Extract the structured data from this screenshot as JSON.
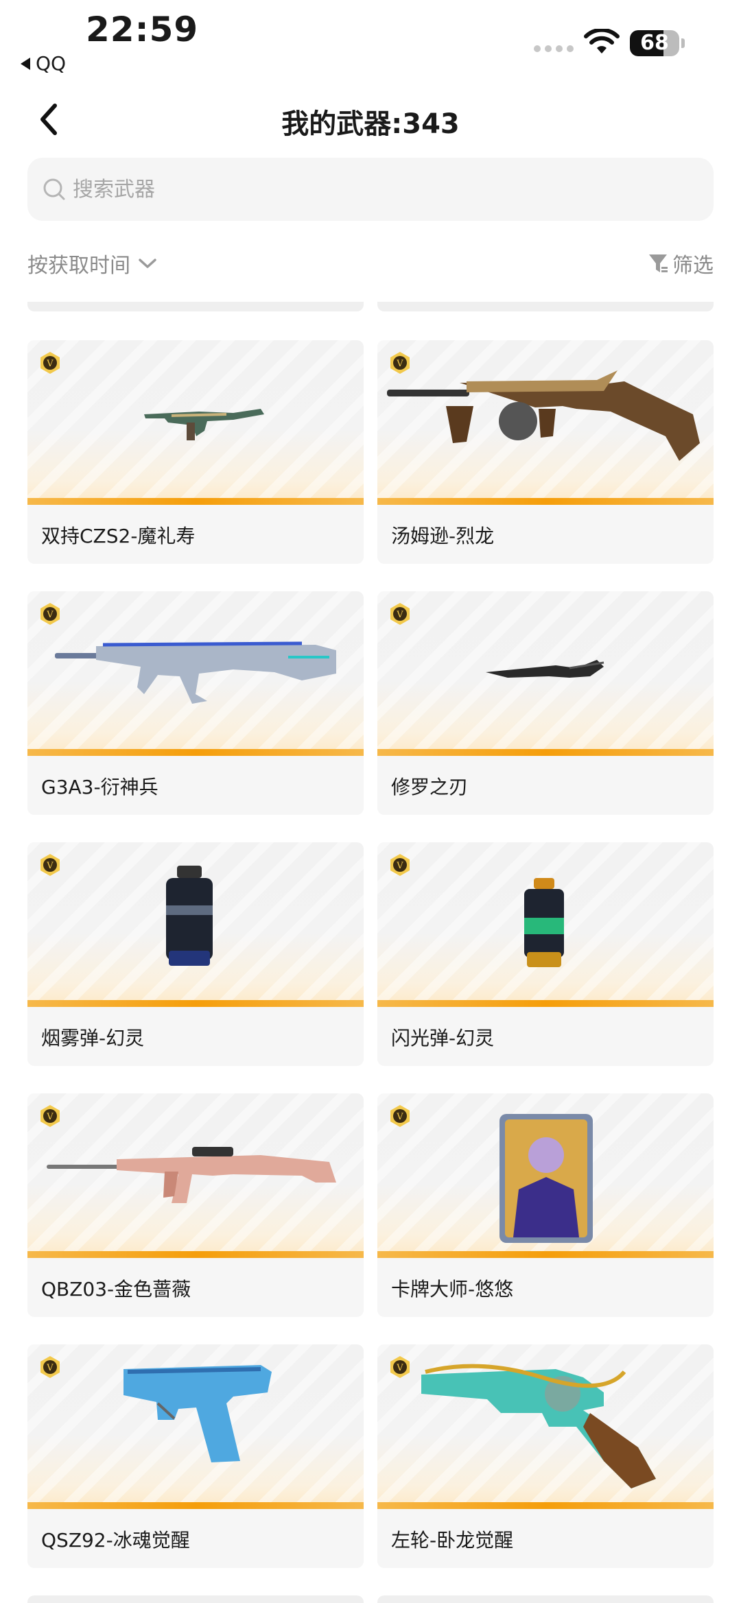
{
  "status_bar": {
    "time": "22:59",
    "back_app": "QQ",
    "battery": "68",
    "battery_level": 0.68
  },
  "header": {
    "back_icon": "chevron-left-icon",
    "title": "我的武器:343"
  },
  "search": {
    "placeholder": "搜索武器",
    "value": "",
    "icon": "search-icon"
  },
  "toolbar": {
    "sort_label": "按获取时间",
    "sort_icon": "chevron-down-icon",
    "filter_label": "筛选",
    "filter_icon": "filter-icon"
  },
  "colors": {
    "accent_bar": "#f59e0b",
    "card_bg": "#f6f6f6",
    "muted_text": "#8a8a8a"
  },
  "weapons": [
    {
      "name": "双持CZS2-魔礼寿",
      "badge": "V"
    },
    {
      "name": "汤姆逊-烈龙",
      "badge": "V"
    },
    {
      "name": "G3A3-衍神兵",
      "badge": "V"
    },
    {
      "name": "修罗之刃",
      "badge": "V"
    },
    {
      "name": "烟雾弹-幻灵",
      "badge": "V"
    },
    {
      "name": "闪光弹-幻灵",
      "badge": "V"
    },
    {
      "name": "QBZ03-金色蔷薇",
      "badge": "V"
    },
    {
      "name": "卡牌大师-悠悠",
      "badge": "V"
    },
    {
      "name": "QSZ92-冰魂觉醒",
      "badge": "V"
    },
    {
      "name": "左轮-卧龙觉醒",
      "badge": "V"
    }
  ]
}
